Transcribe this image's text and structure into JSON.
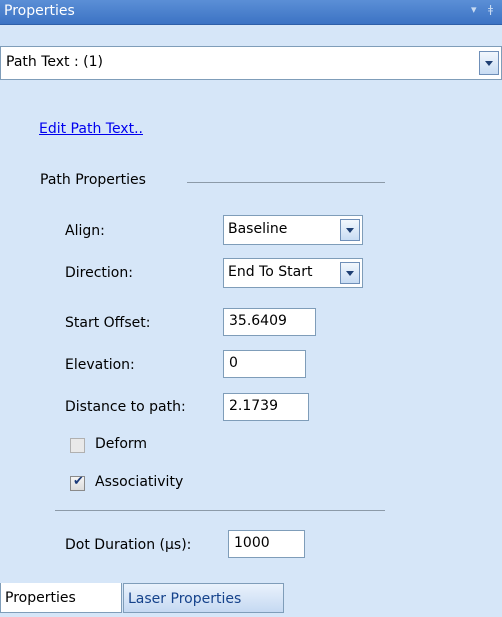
{
  "panel": {
    "title": "Properties",
    "pin_icon": "pin-icon",
    "menu_icon": "dropdown-arrow-icon"
  },
  "object_selector": {
    "value": "Path Text : (1)"
  },
  "edit_link": "Edit Path Text..",
  "section_title": "Path Properties",
  "fields": {
    "align": {
      "label": "Align:",
      "value": "Baseline"
    },
    "direction": {
      "label": "Direction:",
      "value": "End To Start"
    },
    "start_offset": {
      "label": "Start Offset:",
      "value": "35.6409"
    },
    "elevation": {
      "label": "Elevation:",
      "value": "0"
    },
    "distance": {
      "label": "Distance to path:",
      "value": "2.1739"
    }
  },
  "checkboxes": {
    "deform": {
      "label": "Deform",
      "checked": false
    },
    "associativity": {
      "label": "Associativity",
      "checked": true
    }
  },
  "dot_duration": {
    "label": "Dot Duration (µs):",
    "value": "1000"
  },
  "tabs": [
    {
      "label": "Properties",
      "active": true
    },
    {
      "label": "Laser Properties",
      "active": false
    }
  ],
  "colors": {
    "panel_bg": "#d6e6f8",
    "title_bg": "#3c73c4",
    "link": "#0000ee"
  }
}
